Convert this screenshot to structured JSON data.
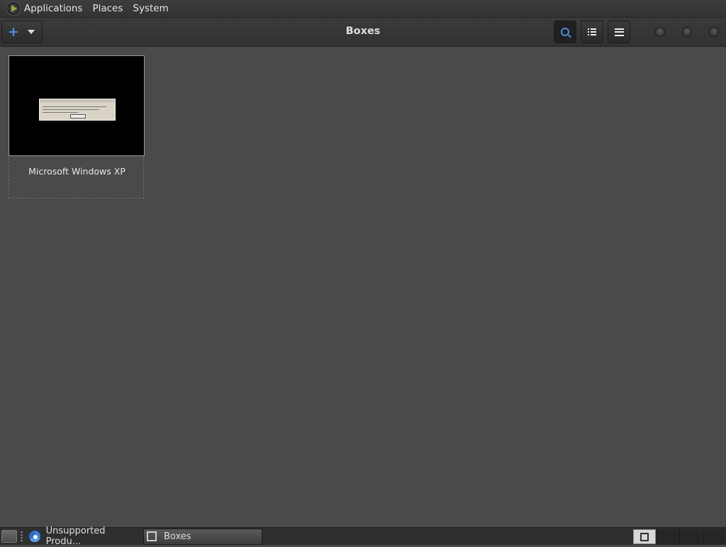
{
  "top_panel": {
    "menus": [
      "Applications",
      "Places",
      "System"
    ]
  },
  "header": {
    "title": "Boxes",
    "new_button_icon": "plus-icon",
    "accent": "#4a90d9"
  },
  "boxes": [
    {
      "name": "Microsoft Windows XP",
      "thumbnail": "black screen with small dialog"
    }
  ],
  "taskbar": {
    "tasks": [
      {
        "label": "Unsupported Produ...",
        "icon": "chrome-icon",
        "active": false
      },
      {
        "label": "Boxes",
        "icon": "boxes-icon",
        "active": true
      }
    ]
  }
}
